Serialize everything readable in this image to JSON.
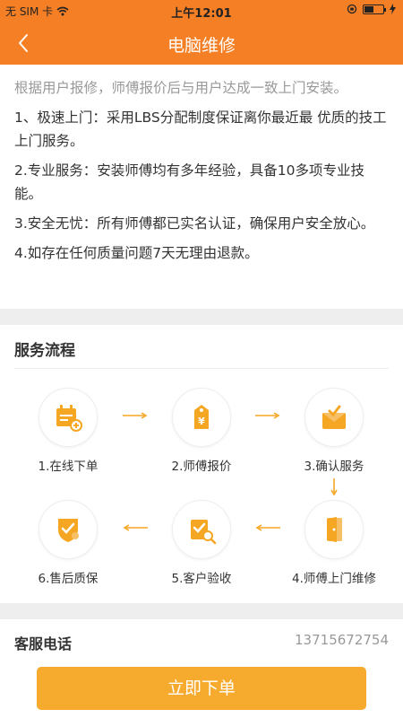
{
  "status_bar": {
    "carrier": "无 SIM 卡",
    "time": "上午12:01",
    "battery_level": 0.5
  },
  "nav": {
    "title": "电脑维修"
  },
  "intro": {
    "lead": "根据用户报修，师傅报价后与用户达成一致上门安装。",
    "items": [
      "1、极速上门：采用LBS分配制度保证离你最近最 优质的技工上门服务。",
      "2.专业服务：安装师傅均有多年经验，具备10多项专业技能。",
      "3.安全无忧：所有师傅都已实名认证，确保用户安全放心。",
      "4.如存在任何质量问题7天无理由退款。"
    ]
  },
  "flow": {
    "heading": "服务流程",
    "steps": [
      {
        "label": "1.在线下单",
        "icon": "calendar-add-icon"
      },
      {
        "label": "2.师傅报价",
        "icon": "price-tag-icon"
      },
      {
        "label": "3.确认服务",
        "icon": "confirm-box-icon"
      },
      {
        "label": "4.师傅上门维修",
        "icon": "door-icon"
      },
      {
        "label": "5.客户验收",
        "icon": "inspect-icon"
      },
      {
        "label": "6.售后质保",
        "icon": "shield-icon"
      }
    ]
  },
  "service": {
    "label": "客服电话",
    "phone": "13715672754"
  },
  "order_button": "立即下单",
  "colors": {
    "brand": "#f57f24",
    "accent": "#f7ab2e",
    "icon": "#f5a623"
  }
}
